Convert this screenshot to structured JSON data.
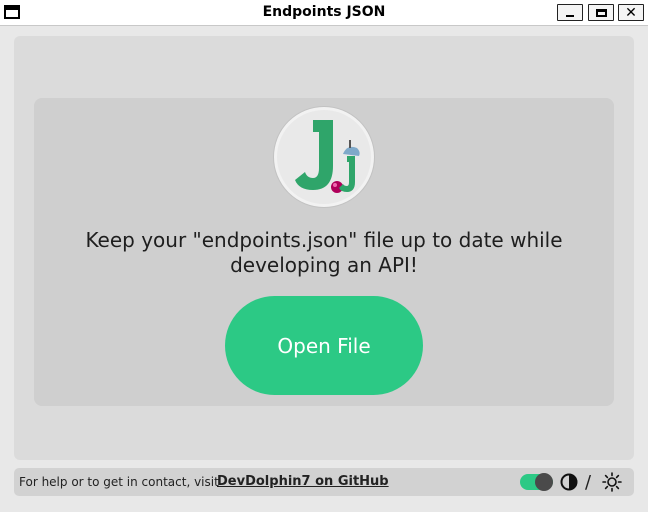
{
  "window": {
    "title": "Endpoints JSON",
    "minimize_label": "_",
    "maximize_label": "□",
    "close_label": "✕"
  },
  "main": {
    "logo_icon": "endpoints-json-logo",
    "tagline": "Keep your \"endpoints.json\" file up to date while developing an API!",
    "open_button": "Open File"
  },
  "footer": {
    "help_text": "For help or to get in contact, visit",
    "link_text": "DevDolphin7 on GitHub",
    "theme_toggle": "dark-light-toggle",
    "separator": "/",
    "dark_icon": "half-moon-icon",
    "light_icon": "sun-icon"
  },
  "colors": {
    "accent": "#2cc985",
    "background": "#e8e8e8",
    "panel": "#dbdbdb",
    "card": "#cfcfcf"
  }
}
